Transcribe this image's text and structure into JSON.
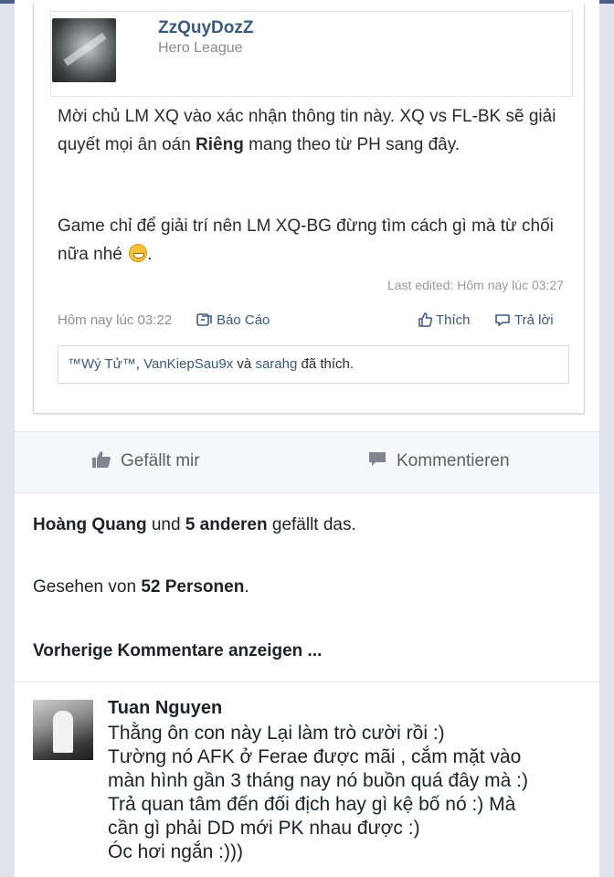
{
  "post": {
    "author": "ZzQuyDozZ",
    "rank": "Hero League",
    "body_line1_a": "Mời chủ LM XQ vào xác nhận thông tin này. XQ vs FL-BK sẽ giải quyết mọi ân oán ",
    "body_line1_bold": "Riêng",
    "body_line1_b": " mang theo từ PH sang đây.",
    "body_line2": "Game chỉ để giải trí nên LM XQ-BG đừng tìm cách gì mà từ chối nữa nhé ",
    "body_line2_end": ".",
    "last_edited": "Last edited: Hôm nay lúc 03:27",
    "time": "Hôm nay lúc 03:22",
    "report_label": "Báo Cáo",
    "like_label": "Thích",
    "reply_label": "Trả lời",
    "likers": [
      "™Wý Tử™",
      "VanKiepSau9x",
      "sarahg"
    ],
    "likers_sep1": ", ",
    "likers_sep2": " và ",
    "likers_suffix": " đã thích."
  },
  "actions": {
    "like_label": "Gefällt mir",
    "comment_label": "Kommentieren"
  },
  "likes_summary": {
    "name": "Hoàng Quang",
    "mid": " und ",
    "count_text": "5 anderen",
    "suffix": " gefällt das."
  },
  "seen": {
    "prefix": "Gesehen von ",
    "count_text": "52 Personen",
    "suffix": "."
  },
  "previous_comments_label": "Vorherige Kommentare anzeigen ...",
  "comment": {
    "author": "Tuan Nguyen",
    "lines": [
      "Thằng ôn con này Lại làm trò cười rồi :)",
      "Tường nó AFK ở Ferae được mãi  , cắm mặt vào",
      "màn hình gần 3 tháng nay nó buồn quá đây mà :)",
      "Trả quan tâm đến đối địch hay gì kệ bố nó :) Mà",
      "cần gì phải DD mới PK nhau được :)",
      "Óc hơi ngắn :)))"
    ]
  },
  "colors": {
    "link": "#3a5a7e",
    "fb_bg": "#dfe3ee",
    "topbar": "#4b5f8d"
  }
}
